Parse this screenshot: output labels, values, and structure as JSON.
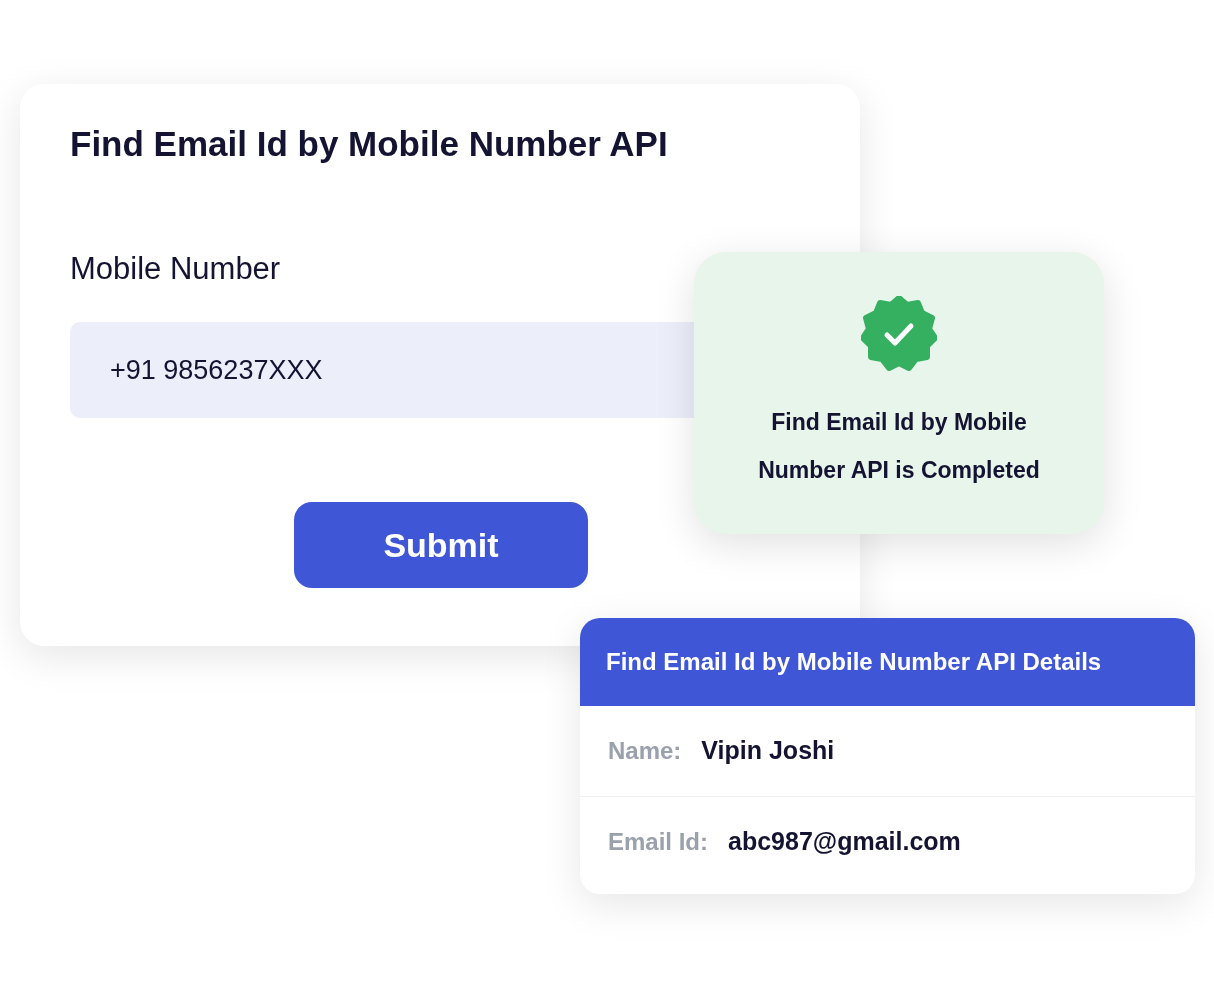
{
  "form": {
    "title": "Find Email Id by Mobile Number API",
    "field_label": "Mobile Number",
    "field_value": "+91 9856237XXX",
    "submit": "Submit"
  },
  "success": {
    "message": "Find Email Id by Mobile Number API is Completed"
  },
  "details": {
    "title": "Find Email Id by Mobile Number API Details",
    "rows": [
      {
        "label": "Name:",
        "value": "Vipin Joshi"
      },
      {
        "label": "Email Id:",
        "value": "abc987@gmail.com"
      }
    ]
  }
}
